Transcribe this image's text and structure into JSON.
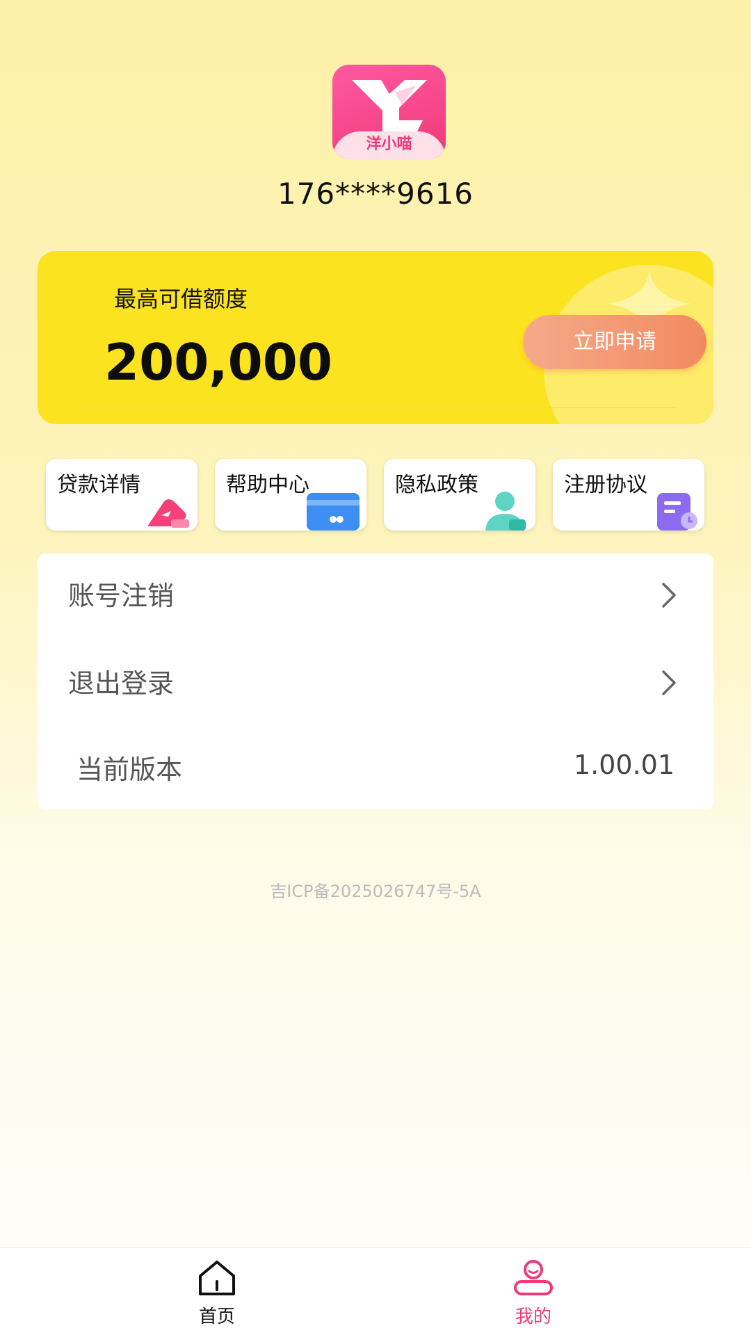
{
  "app": {
    "logo_text": "洋小喵",
    "phone": "176****9616"
  },
  "quota": {
    "label": "最高可借额度",
    "amount": "200,000",
    "apply_label": "立即申请"
  },
  "shortcuts": [
    {
      "label": "贷款详情",
      "icon": "wallet-icon"
    },
    {
      "label": "帮助中心",
      "icon": "card-icon"
    },
    {
      "label": "隐私政策",
      "icon": "user-icon"
    },
    {
      "label": "注册协议",
      "icon": "document-clock-icon"
    }
  ],
  "menu": {
    "account_cancel": "账号注销",
    "logout": "退出登录",
    "version_label": "当前版本",
    "version_value": "1.00.01"
  },
  "icp": "吉ICP备2025026747号-5A",
  "tabbar": {
    "home": "首页",
    "mine": "我的"
  },
  "colors": {
    "accent": "#f0387a",
    "card": "#fce31f",
    "button": "#f28a5f"
  }
}
